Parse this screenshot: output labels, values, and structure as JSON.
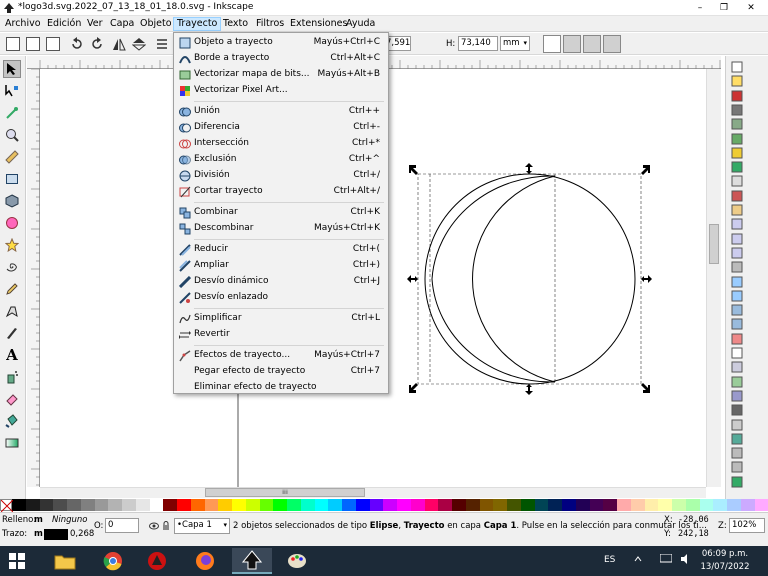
{
  "window": {
    "title": "*logo3d.svg.2022_07_13_18_01_18.0.svg - Inkscape",
    "minimize": "–",
    "maximize": "❐",
    "close": "✕"
  },
  "menubar": {
    "items": [
      "Archivo",
      "Edición",
      "Ver",
      "Capa",
      "Objeto",
      "Trayecto",
      "Texto",
      "Filtros",
      "Extensiones",
      "Ayuda"
    ],
    "active": "Trayecto"
  },
  "toolbar": {
    "w_value": "7,591",
    "h_label": "H:",
    "h_value": "73,140",
    "unit": "mm"
  },
  "trayecto_menu": {
    "groups": [
      [
        {
          "label": "Objeto a trayecto",
          "shortcut": "Mayús+Ctrl+C",
          "icon": "object-to-path-icon"
        },
        {
          "label": "Borde a trayecto",
          "shortcut": "Ctrl+Alt+C",
          "icon": "stroke-to-path-icon"
        },
        {
          "label": "Vectorizar mapa de bits...",
          "shortcut": "Mayús+Alt+B",
          "icon": "trace-bitmap-icon"
        },
        {
          "label": "Vectorizar Pixel Art...",
          "shortcut": "",
          "icon": "trace-pixel-art-icon"
        }
      ],
      [
        {
          "label": "Unión",
          "shortcut": "Ctrl++",
          "icon": "union-icon"
        },
        {
          "label": "Diferencia",
          "shortcut": "Ctrl+-",
          "icon": "difference-icon"
        },
        {
          "label": "Intersección",
          "shortcut": "Ctrl+*",
          "icon": "intersection-icon"
        },
        {
          "label": "Exclusión",
          "shortcut": "Ctrl+^",
          "icon": "exclusion-icon"
        },
        {
          "label": "División",
          "shortcut": "Ctrl+/",
          "icon": "division-icon"
        },
        {
          "label": "Cortar trayecto",
          "shortcut": "Ctrl+Alt+/",
          "icon": "cut-path-icon"
        }
      ],
      [
        {
          "label": "Combinar",
          "shortcut": "Ctrl+K",
          "icon": "combine-icon"
        },
        {
          "label": "Descombinar",
          "shortcut": "Mayús+Ctrl+K",
          "icon": "break-apart-icon"
        }
      ],
      [
        {
          "label": "Reducir",
          "shortcut": "Ctrl+(",
          "icon": "inset-icon"
        },
        {
          "label": "Ampliar",
          "shortcut": "Ctrl+)",
          "icon": "outset-icon"
        },
        {
          "label": "Desvío dinámico",
          "shortcut": "Ctrl+J",
          "icon": "dynamic-offset-icon"
        },
        {
          "label": "Desvío enlazado",
          "shortcut": "",
          "icon": "linked-offset-icon"
        }
      ],
      [
        {
          "label": "Simplificar",
          "shortcut": "Ctrl+L",
          "icon": "simplify-icon"
        },
        {
          "label": "Revertir",
          "shortcut": "",
          "icon": "reverse-icon"
        }
      ],
      [
        {
          "label": "Efectos de trayecto...",
          "shortcut": "Mayús+Ctrl+7",
          "icon": "path-effects-icon"
        },
        {
          "label": "Pegar efecto de trayecto",
          "shortcut": "Ctrl+7",
          "icon": ""
        },
        {
          "label": "Eliminar efecto de trayecto",
          "shortcut": "",
          "icon": ""
        }
      ]
    ]
  },
  "status": {
    "fill_label": "Relleno:",
    "fill_mode": "m",
    "fill_value": "Ninguno",
    "stroke_label": "Trazo:",
    "stroke_mode": "m",
    "stroke_width": "0,268",
    "opacity_label": "O:",
    "opacity_value": "0",
    "layer": "•Capa 1",
    "message_prefix": "2 objetos seleccionados de tipo ",
    "message_bold1": "Elipse",
    "message_mid": ", ",
    "message_bold2": "Trayecto",
    "message_mid2": " en capa ",
    "message_bold3": "Capa 1",
    "message_suffix": ". Pulse en la selección para conmutar los ti...",
    "x_label": "X:",
    "x_value": "-28,06",
    "y_label": "Y:",
    "y_value": "242,18",
    "zoom_label": "Z:",
    "zoom_value": "102%"
  },
  "taskbar": {
    "language": "ES",
    "time": "06:09 p.m.",
    "date": "13/07/2022"
  },
  "scroll_handle": "⁞⁞⁞",
  "colors": {
    "accent": "#cce8ff",
    "taskbar": "#1c2a38"
  }
}
